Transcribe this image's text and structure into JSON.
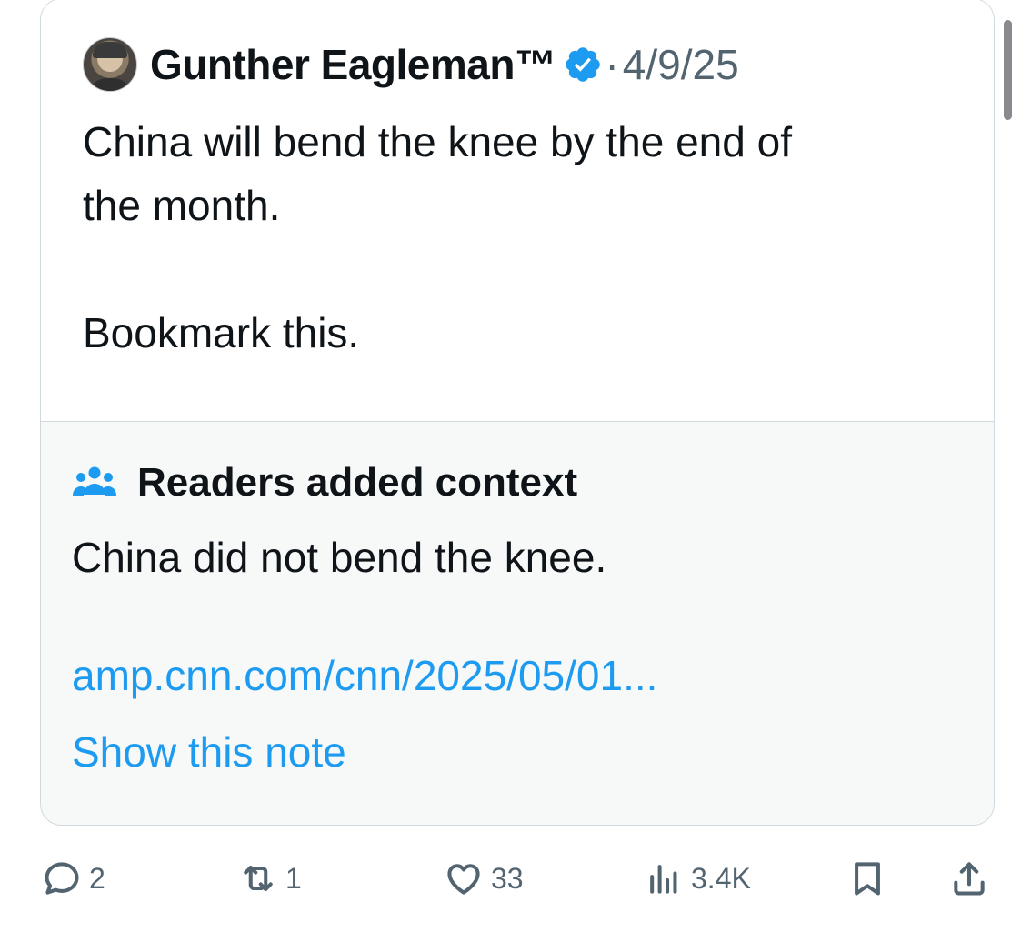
{
  "quoted_post": {
    "author_name": "Gunther Eagleman™",
    "verified": true,
    "separator": "·",
    "date": "4/9/25",
    "text": "China will bend the knee by the end of\nthe month.\n\nBookmark this."
  },
  "community_note": {
    "icon": "people-group-icon",
    "title": "Readers added context",
    "body": "China did not bend the knee.",
    "link_text": "amp.cnn.com/cnn/2025/05/01...",
    "show_note_label": "Show this note"
  },
  "actions": {
    "reply_count": "2",
    "repost_count": "1",
    "like_count": "33",
    "views_count": "3.4K"
  },
  "colors": {
    "accent": "#1d9bf0",
    "secondary_text": "#536471",
    "border": "#cfd9de",
    "note_background": "#f7f9f9"
  }
}
